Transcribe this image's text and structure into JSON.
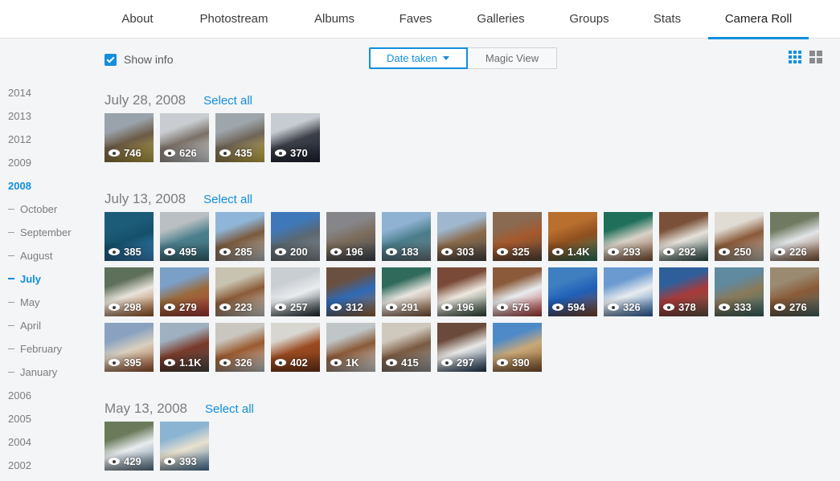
{
  "nav": {
    "tabs": [
      {
        "label": "About",
        "active": false
      },
      {
        "label": "Photostream",
        "active": false
      },
      {
        "label": "Albums",
        "active": false
      },
      {
        "label": "Faves",
        "active": false
      },
      {
        "label": "Galleries",
        "active": false
      },
      {
        "label": "Groups",
        "active": false
      },
      {
        "label": "Stats",
        "active": false
      },
      {
        "label": "Camera Roll",
        "active": true
      }
    ]
  },
  "toolbar": {
    "show_info_label": "Show info",
    "show_info_checked": true,
    "sort_options": [
      "Date taken",
      "Magic View"
    ],
    "sort_selected": "Date taken",
    "view_icons": [
      "small-grid-icon",
      "large-grid-icon"
    ],
    "view_selected": "small-grid-icon"
  },
  "sidebar": {
    "items": [
      {
        "label": "2014",
        "type": "year",
        "active": false
      },
      {
        "label": "2013",
        "type": "year",
        "active": false
      },
      {
        "label": "2012",
        "type": "year",
        "active": false
      },
      {
        "label": "2009",
        "type": "year",
        "active": false
      },
      {
        "label": "2008",
        "type": "year",
        "active": true
      },
      {
        "label": "October",
        "type": "month",
        "active": false
      },
      {
        "label": "September",
        "type": "month",
        "active": false
      },
      {
        "label": "August",
        "type": "month",
        "active": false
      },
      {
        "label": "July",
        "type": "month",
        "active": true
      },
      {
        "label": "May",
        "type": "month",
        "active": false
      },
      {
        "label": "April",
        "type": "month",
        "active": false
      },
      {
        "label": "February",
        "type": "month",
        "active": false
      },
      {
        "label": "January",
        "type": "month",
        "active": false
      },
      {
        "label": "2006",
        "type": "year",
        "active": false
      },
      {
        "label": "2005",
        "type": "year",
        "active": false
      },
      {
        "label": "2004",
        "type": "year",
        "active": false
      },
      {
        "label": "2002",
        "type": "year",
        "active": false
      }
    ]
  },
  "sections": [
    {
      "date": "July 28, 2008",
      "select_all": "Select all",
      "photos": [
        {
          "views": "746",
          "colors": [
            "#9aa3ab",
            "#6b5a45",
            "#c8b24a"
          ]
        },
        {
          "views": "626",
          "colors": [
            "#c9cdd1",
            "#7a7068",
            "#e9ecef"
          ]
        },
        {
          "views": "435",
          "colors": [
            "#9ea6ac",
            "#6e6457",
            "#d9c14a"
          ]
        },
        {
          "views": "370",
          "colors": [
            "#c7ccd2",
            "#3c3f48",
            "#1f2535"
          ]
        }
      ]
    },
    {
      "date": "July 13, 2008",
      "select_all": "Select all",
      "photos": [
        {
          "views": "385",
          "colors": [
            "#1d5c78",
            "#15506a",
            "#3f8fd0"
          ]
        },
        {
          "views": "495",
          "colors": [
            "#b9bfc2",
            "#4b7f8c",
            "#3b6f7c"
          ]
        },
        {
          "views": "285",
          "colors": [
            "#8fb6d8",
            "#7a5a3d",
            "#c5c9cc"
          ]
        },
        {
          "views": "200",
          "colors": [
            "#3f78b8",
            "#5b6770",
            "#8b8f93"
          ]
        },
        {
          "views": "196",
          "colors": [
            "#86868a",
            "#7b6b5a",
            "#3f4a55"
          ]
        },
        {
          "views": "183",
          "colors": [
            "#8fb2d2",
            "#4a7d8a",
            "#6f7d85"
          ]
        },
        {
          "views": "303",
          "colors": [
            "#9fb8d0",
            "#8a6a4a",
            "#4e4a48"
          ]
        },
        {
          "views": "325",
          "colors": [
            "#8a6a50",
            "#a6582c",
            "#5a4b40"
          ]
        },
        {
          "views": "1.4K",
          "colors": [
            "#b9702f",
            "#8f4f1f",
            "#2f7c62"
          ]
        },
        {
          "views": "293",
          "colors": [
            "#1f6f5a",
            "#d8d2c8",
            "#8a5a38"
          ]
        },
        {
          "views": "292",
          "colors": [
            "#7a5038",
            "#e5e1da",
            "#2f4f4a"
          ]
        },
        {
          "views": "250",
          "colors": [
            "#e0dcd4",
            "#8a5a3a",
            "#c9c4ba"
          ]
        },
        {
          "views": "226",
          "colors": [
            "#6f7a60",
            "#e2e5e8",
            "#8a5a3a"
          ]
        }
      ]
    },
    {
      "date": "",
      "select_all": "",
      "photos": [
        {
          "views": "298",
          "colors": [
            "#5e6f5a",
            "#e9e4dc",
            "#a65a22"
          ]
        },
        {
          "views": "279",
          "colors": [
            "#7aa0c8",
            "#9a6a3a",
            "#b33a3a"
          ]
        },
        {
          "views": "223",
          "colors": [
            "#c8c2b0",
            "#8a5a38",
            "#d9dcd7"
          ]
        },
        {
          "views": "257",
          "colors": [
            "#c9ced3",
            "#e9ecee",
            "#1e2a2f"
          ]
        },
        {
          "views": "312",
          "colors": [
            "#6a5040",
            "#2f6ab8",
            "#a56a38"
          ]
        },
        {
          "views": "291",
          "colors": [
            "#2f6a5a",
            "#e8e5e0",
            "#8a5a3a"
          ]
        },
        {
          "views": "196",
          "colors": [
            "#7a4a38",
            "#efe9e0",
            "#2f4a3a"
          ]
        },
        {
          "views": "575",
          "colors": [
            "#8a5a3a",
            "#e8ecef",
            "#b83a3a"
          ]
        },
        {
          "views": "594",
          "colors": [
            "#3f7fc0",
            "#1f5fb8",
            "#8a4a2a"
          ]
        },
        {
          "views": "326",
          "colors": [
            "#6a9ad0",
            "#e8ecef",
            "#2f6ab0"
          ]
        },
        {
          "views": "378",
          "colors": [
            "#2f5f9a",
            "#a83a3a",
            "#6a5a4a"
          ]
        },
        {
          "views": "333",
          "colors": [
            "#5f8aa0",
            "#8a7a5a",
            "#3a6a6a"
          ]
        },
        {
          "views": "276",
          "colors": [
            "#9a8a70",
            "#8a5a38",
            "#4a6a6a"
          ]
        }
      ]
    },
    {
      "date": "",
      "select_all": "",
      "photos": [
        {
          "views": "395",
          "colors": [
            "#8aa2c0",
            "#d8cfbf",
            "#a6582c"
          ]
        },
        {
          "views": "1.1K",
          "colors": [
            "#9fb0c0",
            "#7a3a2a",
            "#4a4a48"
          ]
        },
        {
          "views": "326",
          "colors": [
            "#c9c6bf",
            "#9a5a30",
            "#d0d3d6"
          ]
        },
        {
          "views": "402",
          "colors": [
            "#d8d6d0",
            "#9a4a20",
            "#7a3a1a"
          ]
        },
        {
          "views": "1K",
          "colors": [
            "#c0c6c8",
            "#8a5a38",
            "#dfe2e5"
          ]
        },
        {
          "views": "415",
          "colors": [
            "#cfc8bc",
            "#7a5a42",
            "#a0a6a8"
          ]
        },
        {
          "views": "297",
          "colors": [
            "#6a4a3a",
            "#e8e8e6",
            "#1f3a5a"
          ]
        },
        {
          "views": "390",
          "colors": [
            "#4f8ac8",
            "#c8a878",
            "#8a5a30"
          ]
        }
      ]
    },
    {
      "date": "May 13, 2008",
      "select_all": "Select all",
      "photos": [
        {
          "views": "429",
          "colors": [
            "#6a7a5a",
            "#e8ecef",
            "#5f7a90"
          ]
        },
        {
          "views": "393",
          "colors": [
            "#8ab4d2",
            "#e9e1cf",
            "#4f7fa8"
          ]
        }
      ]
    }
  ]
}
